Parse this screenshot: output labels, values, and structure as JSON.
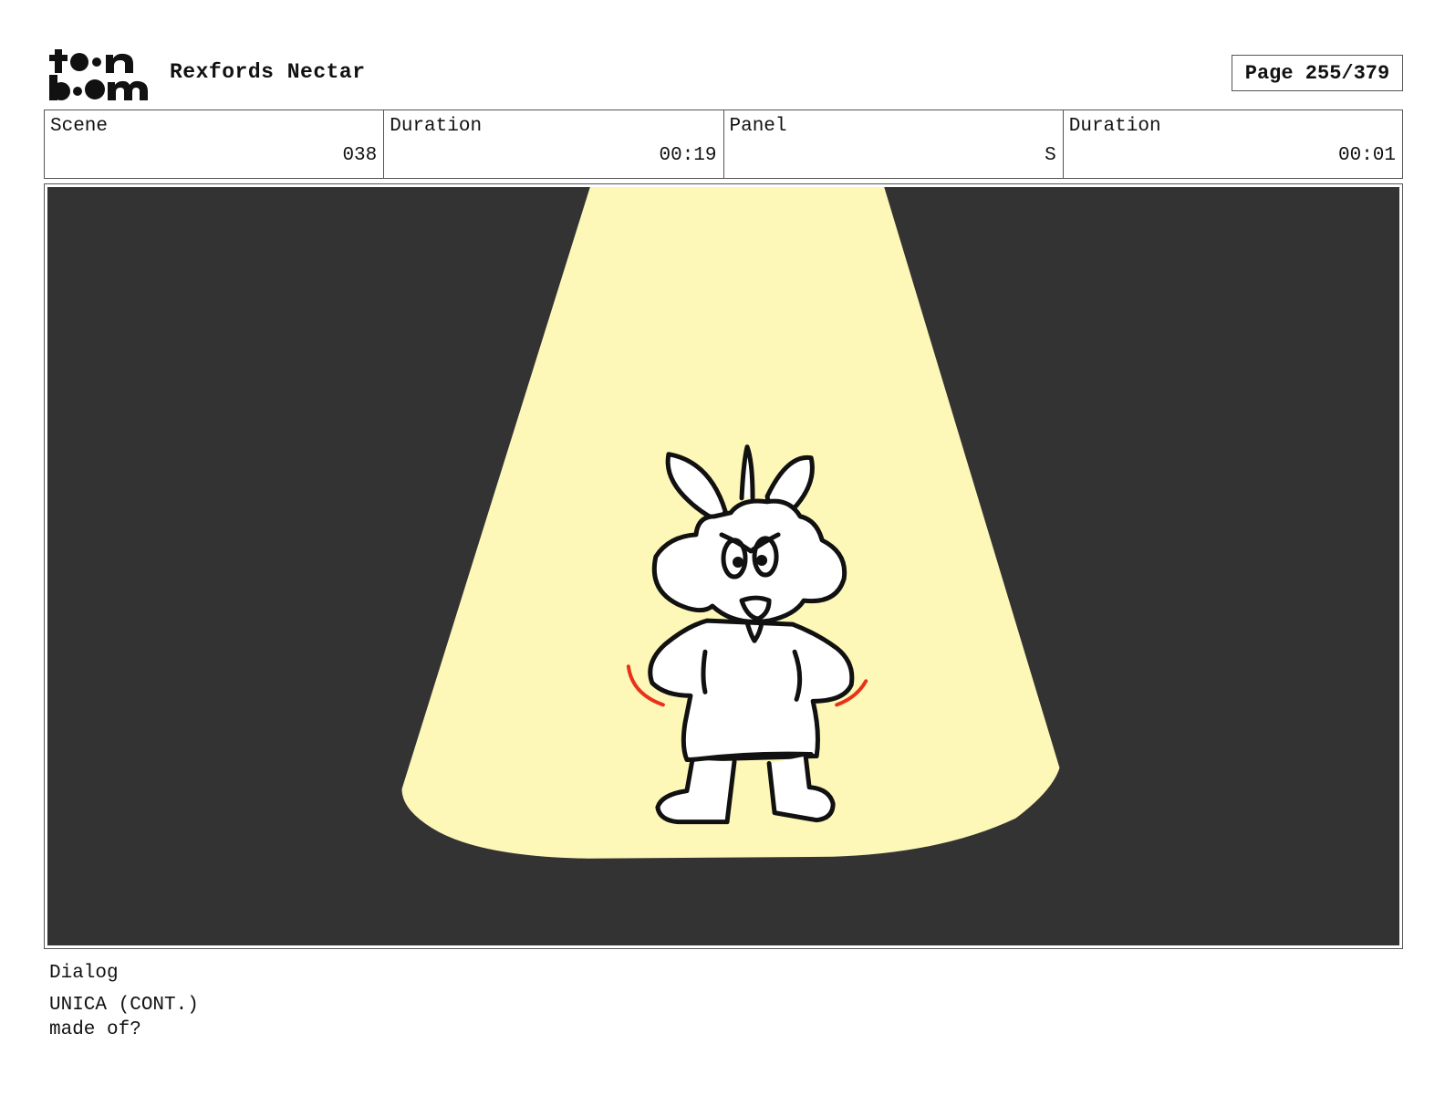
{
  "header": {
    "logo_text": "toon boom",
    "project_title": "Rexfords Nectar",
    "page_indicator": "Page 255/379"
  },
  "info": {
    "scene_label": "Scene",
    "scene_value": "038",
    "scene_duration_label": "Duration",
    "scene_duration_value": "00:19",
    "panel_label": "Panel",
    "panel_value": "S",
    "panel_duration_label": "Duration",
    "panel_duration_value": "00:01"
  },
  "panel": {
    "background_color": "#333333",
    "spotlight_color": "#fdf7b8",
    "motion_mark_color": "#e8321a"
  },
  "dialog": {
    "label": "Dialog",
    "character": "UNICA (CONT.)",
    "line": "made of?"
  }
}
